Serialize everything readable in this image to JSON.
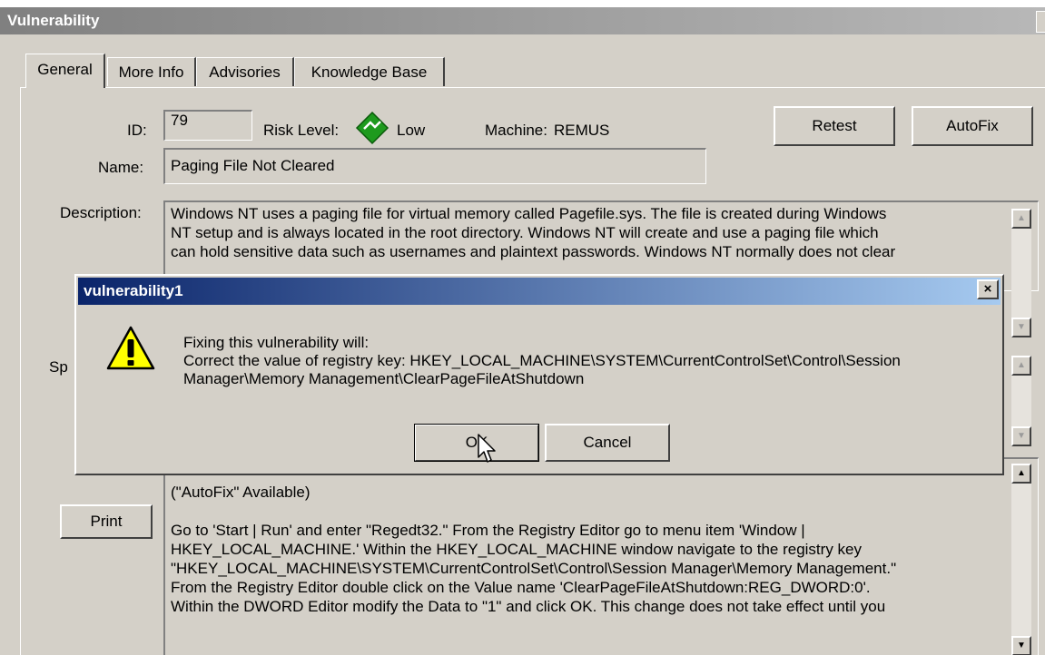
{
  "window": {
    "title": "Vulnerability"
  },
  "tabs": [
    {
      "label": "General"
    },
    {
      "label": "More Info"
    },
    {
      "label": "Advisories"
    },
    {
      "label": "Knowledge Base"
    }
  ],
  "general": {
    "id_label": "ID:",
    "id_value": "79",
    "risk_label": "Risk Level:",
    "risk_value": "Low",
    "machine_label": "Machine:",
    "machine_value": "REMUS",
    "retest_button": "Retest",
    "autofix_button": "AutoFix",
    "name_label": "Name:",
    "name_value": "Paging File Not Cleared",
    "description_label": "Description:",
    "description_lines": [
      "Windows NT uses a paging file for virtual memory called Pagefile.sys.  The file is created during Windows",
      "NT setup and is always located in the root directory.  Windows NT will create and use a paging file which",
      "can hold sensitive data such as usernames and plaintext passwords.  Windows NT normally  does not clear"
    ],
    "sp_label": "Sp",
    "print_button": "Print",
    "fix_lines": [
      "(\"AutoFix\" Available)",
      "",
      "Go to 'Start | Run' and enter \"Regedt32.\"  From the Registry Editor go to menu item  'Window |",
      "HKEY_LOCAL_MACHINE.'  Within the HKEY_LOCAL_MACHINE window navigate to the registry key",
      "\"HKEY_LOCAL_MACHINE\\SYSTEM\\CurrentControlSet\\Control\\Session Manager\\Memory Management.\"",
      "From the Registry Editor double click on the Value name 'ClearPageFileAtShutdown:REG_DWORD:0'.",
      "Within the DWORD Editor modify the Data to \"1\" and click OK.  This change does not take effect until you"
    ]
  },
  "dialog": {
    "title": "vulnerability1",
    "message_lines": [
      "Fixing this vulnerability will:",
      "Correct the value of registry key: HKEY_LOCAL_MACHINE\\SYSTEM\\CurrentControlSet\\Control\\Session",
      "Manager\\Memory Management\\ClearPageFileAtShutdown"
    ],
    "ok_button": "OK",
    "cancel_button": "Cancel",
    "close_glyph": "×"
  },
  "icons": {
    "risk": "green-diamond-risk-icon",
    "warning": "warning-icon",
    "cursor": "mouse-pointer-icon"
  },
  "colors": {
    "risk_low": "#1e9a1e",
    "dialog_title": "#0a246a",
    "warning_yellow": "#ffff00"
  }
}
